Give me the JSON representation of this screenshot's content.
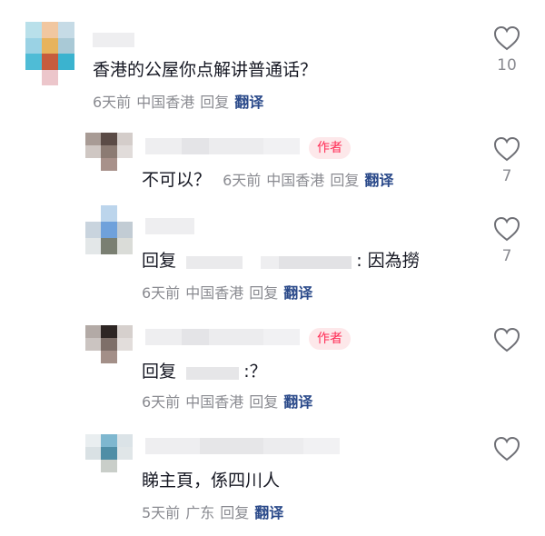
{
  "colors": {
    "meta_gray": "#8a8b91",
    "translate_blue": "#2b4a8a",
    "author_red": "#fe2c55",
    "author_bg": "#fde8ea"
  },
  "comments": [
    {
      "text": "香港的公屋你点解讲普通话？",
      "time": "6天前",
      "location": "中国香港",
      "reply_label": "回复",
      "translate_label": "翻译",
      "like_count": "10",
      "like_icon": "heart-outline-icon"
    },
    {
      "author_badge": "作者",
      "text": "不可以？",
      "time": "6天前",
      "location": "中国香港",
      "reply_label": "回复",
      "translate_label": "翻译",
      "like_count": "7",
      "like_icon": "heart-outline-icon"
    },
    {
      "text_prefix": "回复",
      "text_suffix": ": 因為撈",
      "time": "6天前",
      "location": "中国香港",
      "reply_label": "回复",
      "translate_label": "翻译",
      "like_count": "7",
      "like_icon": "heart-outline-icon"
    },
    {
      "author_badge": "作者",
      "text_prefix": "回复",
      "text_suffix": ":？",
      "time": "6天前",
      "location": "中国香港",
      "reply_label": "回复",
      "translate_label": "翻译",
      "like_count": "",
      "like_icon": "heart-outline-icon"
    },
    {
      "text": "睇主頁，係四川人",
      "time": "5天前",
      "location": "广东",
      "reply_label": "回复",
      "translate_label": "翻译",
      "like_count": "",
      "like_icon": "heart-outline-icon"
    }
  ]
}
